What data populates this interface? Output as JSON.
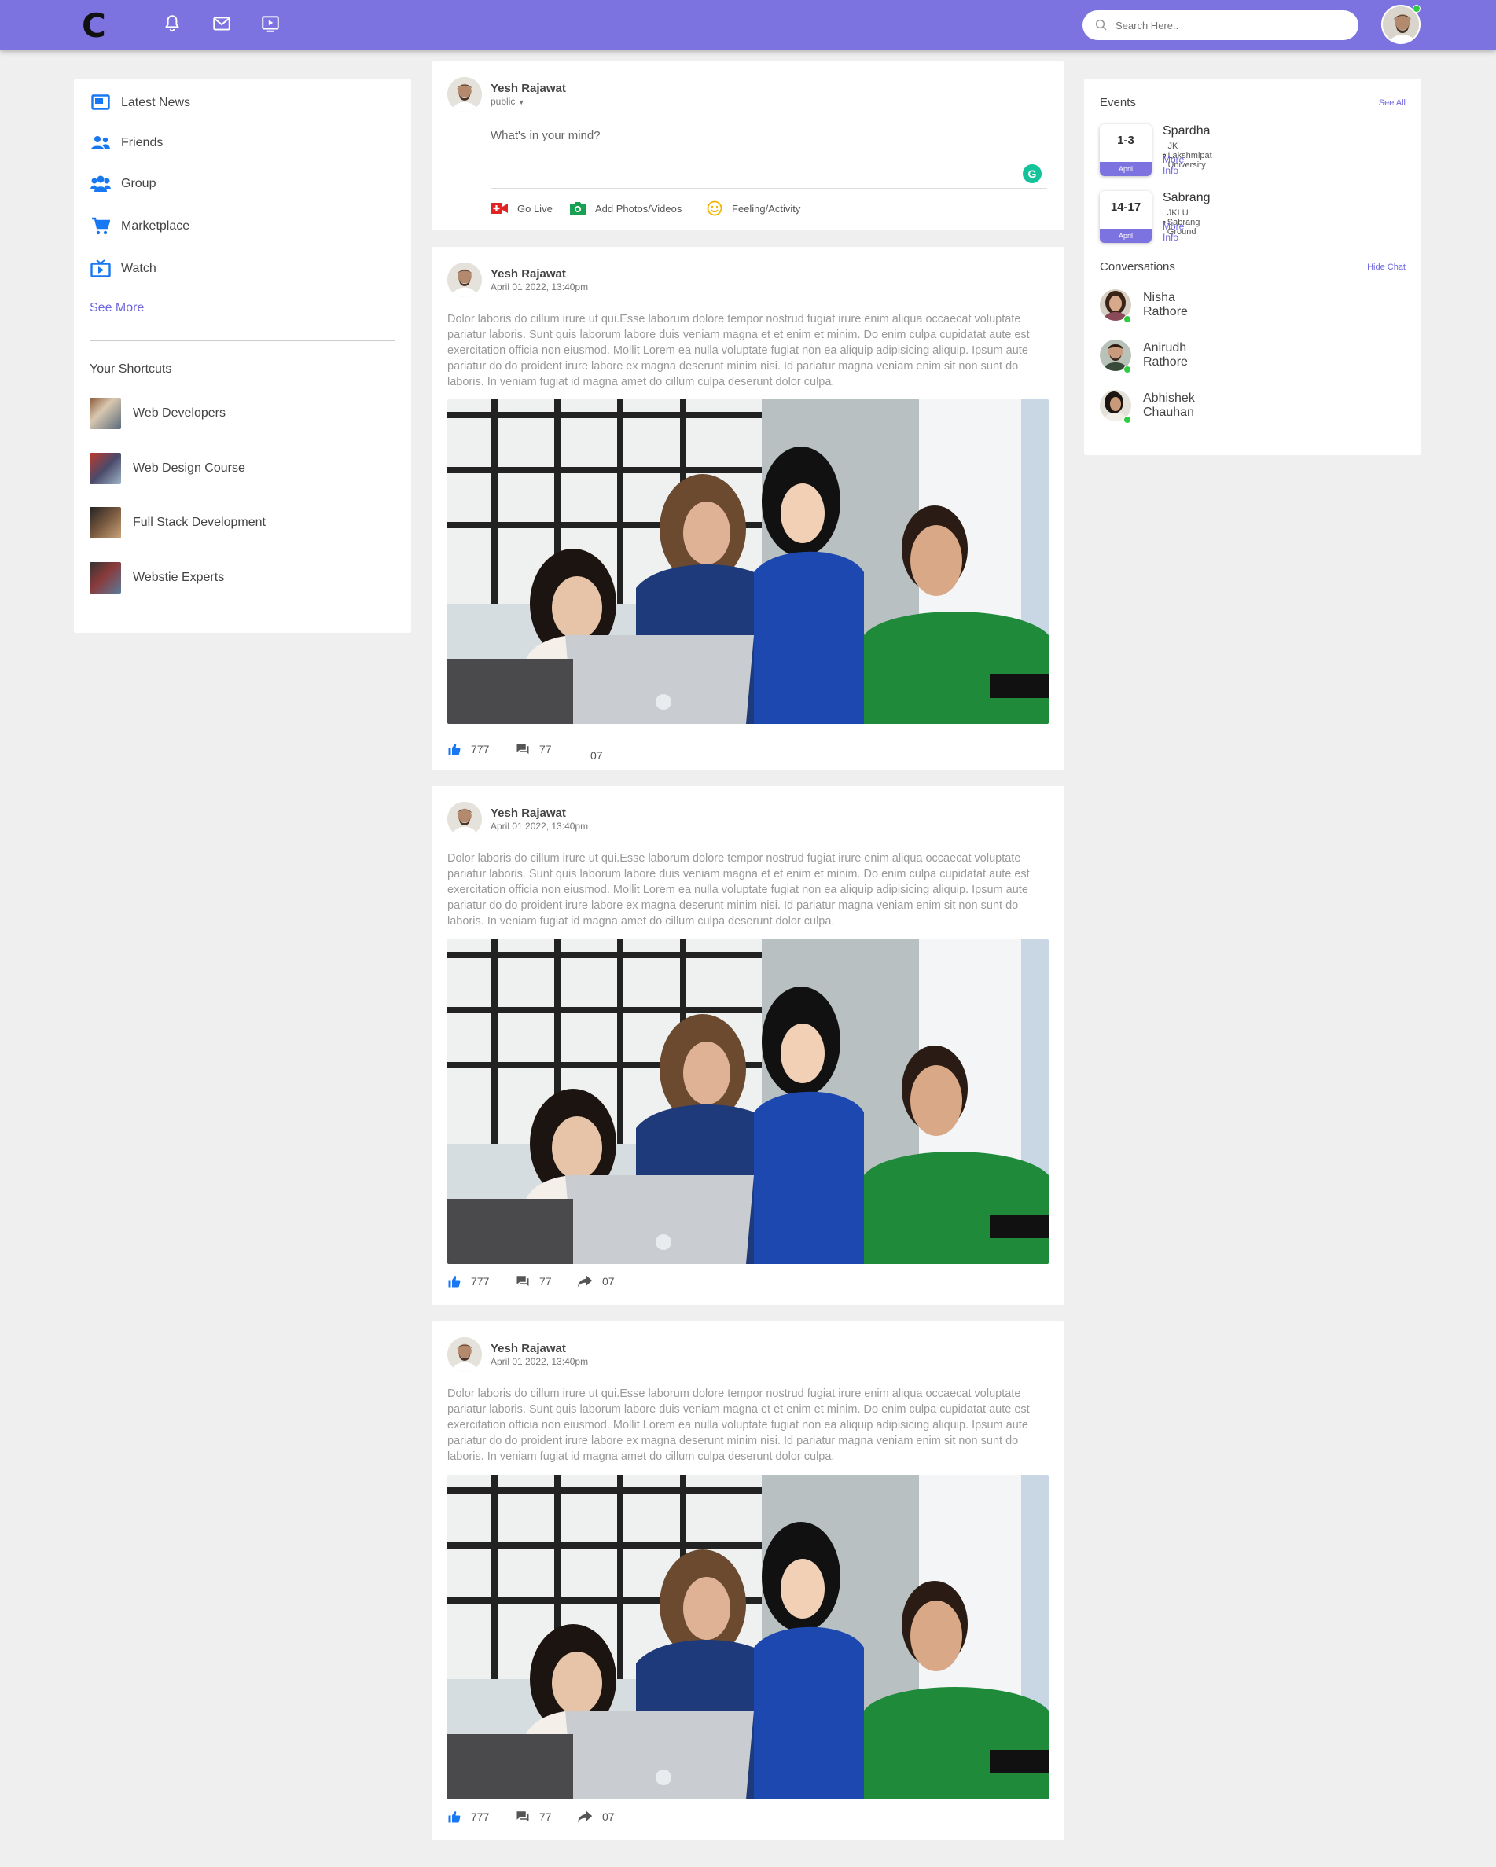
{
  "navbar": {
    "logo": "C",
    "search_placeholder": "Search Here.."
  },
  "left": {
    "menu": [
      {
        "label": "Latest News",
        "icon": "news-icon"
      },
      {
        "label": "Friends",
        "icon": "friends-icon"
      },
      {
        "label": "Group",
        "icon": "group-icon"
      },
      {
        "label": "Marketplace",
        "icon": "cart-icon"
      },
      {
        "label": "Watch",
        "icon": "tv-icon"
      }
    ],
    "see_more": "See More",
    "shortcuts_title": "Your Shortcuts",
    "shortcuts": [
      {
        "label": "Web Developers"
      },
      {
        "label": "Web Design Course"
      },
      {
        "label": "Full Stack Development"
      },
      {
        "label": "Webstie Experts"
      }
    ]
  },
  "composer": {
    "name": "Yesh Rajawat",
    "privacy": "public",
    "placeholder": "What's in your mind?",
    "actions": [
      {
        "label": "Go Live",
        "icon": "live-video-icon"
      },
      {
        "label": "Add Photos/Videos",
        "icon": "camera-icon"
      },
      {
        "label": "Feeling/Activity",
        "icon": "smiley-icon"
      }
    ]
  },
  "posts": [
    {
      "name": "Yesh Rajawat",
      "time": "April 01 2022, 13:40pm",
      "text": "Dolor laboris do cillum irure ut qui.Esse laborum dolore tempor nostrud fugiat irure enim aliqua occaecat voluptate pariatur laboris. Sunt quis laborum labore duis veniam magna et et enim et minim. Do enim culpa cupidatat aute est exercitation officia non eiusmod. Mollit Lorem ea nulla voluptate fugiat non ea aliquip adipisicing aliquip. Ipsum aute pariatur do do proident irure labore ex magna deserunt minim nisi. Id pariatur magna veniam enim sit non sunt do laboris. In veniam fugiat id magna amet do cillum culpa deserunt dolor culpa.",
      "likes": "777",
      "comments": "77",
      "shares": "07"
    },
    {
      "name": "Yesh Rajawat",
      "time": "April 01 2022, 13:40pm",
      "text": "Dolor laboris do cillum irure ut qui.Esse laborum dolore tempor nostrud fugiat irure enim aliqua occaecat voluptate pariatur laboris. Sunt quis laborum labore duis veniam magna et et enim et minim. Do enim culpa cupidatat aute est exercitation officia non eiusmod. Mollit Lorem ea nulla voluptate fugiat non ea aliquip adipisicing aliquip. Ipsum aute pariatur do do proident irure labore ex magna deserunt minim nisi. Id pariatur magna veniam enim sit non sunt do laboris. In veniam fugiat id magna amet do cillum culpa deserunt dolor culpa.",
      "likes": "777",
      "comments": "77",
      "shares": "07"
    },
    {
      "name": "Yesh Rajawat",
      "time": "April 01 2022, 13:40pm",
      "text": "Dolor laboris do cillum irure ut qui.Esse laborum dolore tempor nostrud fugiat irure enim aliqua occaecat voluptate pariatur laboris. Sunt quis laborum labore duis veniam magna et et enim et minim. Do enim culpa cupidatat aute est exercitation officia non eiusmod. Mollit Lorem ea nulla voluptate fugiat non ea aliquip adipisicing aliquip. Ipsum aute pariatur do do proident irure labore ex magna deserunt minim nisi. Id pariatur magna veniam enim sit non sunt do laboris. In veniam fugiat id magna amet do cillum culpa deserunt dolor culpa.",
      "likes": "777",
      "comments": "77",
      "shares": "07"
    }
  ],
  "right": {
    "events_title": "Events",
    "see_all": "See All",
    "events": [
      {
        "date": "1-3",
        "month": "April",
        "name": "Spardha",
        "location": "JK Lakshmipat University",
        "more": "More Info"
      },
      {
        "date": "14-17",
        "month": "April",
        "name": "Sabrang",
        "location": "JKLU Sabrang Ground",
        "more": "More Info"
      }
    ],
    "conversations_title": "Conversations",
    "hide_chat": "Hide Chat",
    "chats": [
      {
        "name": "Nisha Rathore"
      },
      {
        "name": "Anirudh Rathore"
      },
      {
        "name": "Abhishek Chauhan"
      }
    ]
  },
  "colors": {
    "accent": "#7d73e0",
    "online": "#2ecc40",
    "icon_blue": "#1877f2"
  }
}
